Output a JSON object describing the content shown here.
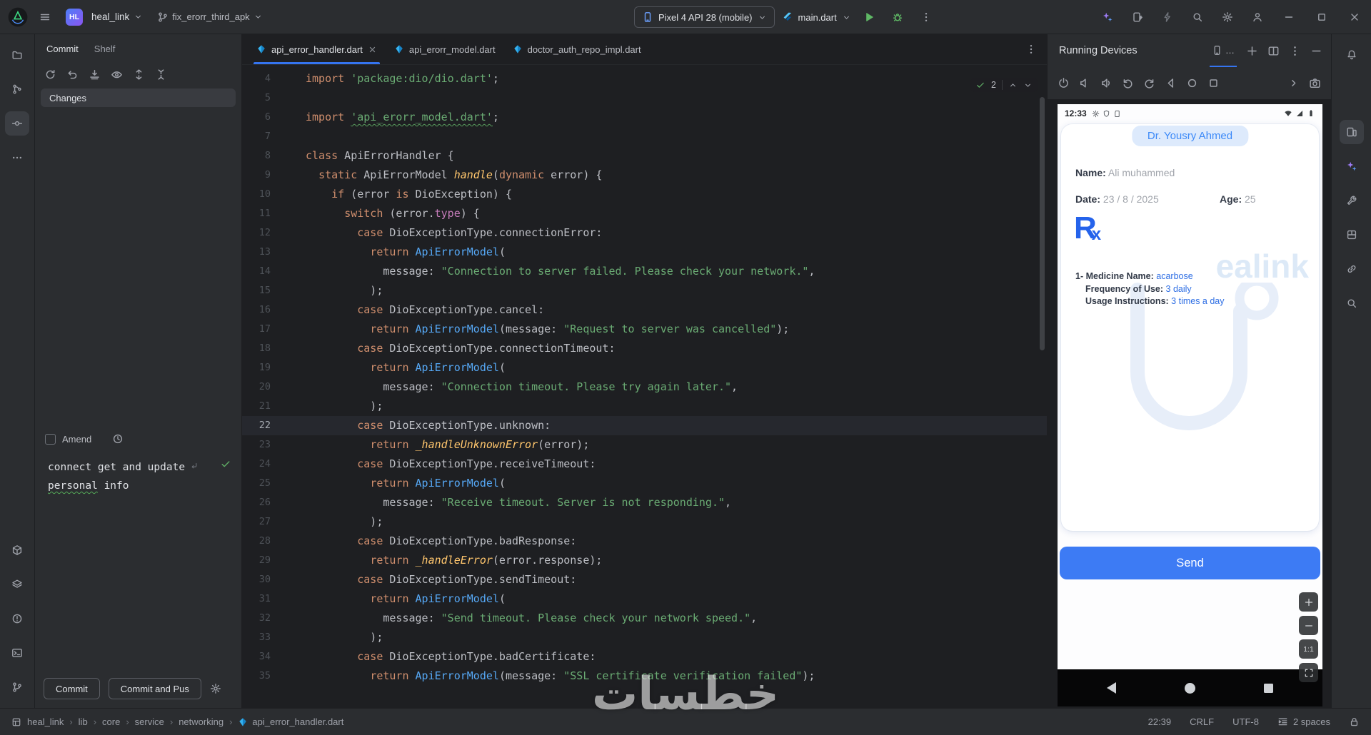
{
  "titlebar": {
    "project": {
      "badge": "HL",
      "name": "heal_link"
    },
    "branch": "fix_erorr_third_apk",
    "device_selector": "Pixel 4 API 28 (mobile)",
    "run_config": "main.dart"
  },
  "commit_panel": {
    "tabs": [
      "Commit",
      "Shelf"
    ],
    "changes_label": "Changes",
    "amend_label": "Amend",
    "message": {
      "line1": "connect get and update",
      "line2_word": "personal",
      "line2_rest": " info"
    },
    "commit_button": "Commit",
    "commit_push_button": "Commit and Pus"
  },
  "editor": {
    "tabs": [
      {
        "label": "api_error_handler.dart"
      },
      {
        "label": "api_erorr_model.dart"
      },
      {
        "label": "doctor_auth_repo_impl.dart"
      }
    ],
    "inspections": {
      "count": "2"
    },
    "code": {
      "current_line": 22,
      "lines": [
        {
          "n": 4,
          "t": [
            {
              "c": "k",
              "x": "import"
            },
            {
              "c": "d",
              "x": " "
            },
            {
              "c": "s",
              "x": "'package:dio/dio.dart'"
            },
            {
              "c": "d",
              "x": ";"
            }
          ]
        },
        {
          "n": 5,
          "t": []
        },
        {
          "n": 6,
          "t": [
            {
              "c": "k",
              "x": "import"
            },
            {
              "c": "d",
              "x": " "
            },
            {
              "c": "s sq",
              "x": "'api_erorr_model.dart'"
            },
            {
              "c": "d",
              "x": ";"
            }
          ]
        },
        {
          "n": 7,
          "t": []
        },
        {
          "n": 8,
          "t": [
            {
              "c": "k",
              "x": "class"
            },
            {
              "c": "d",
              "x": " ApiErrorHandler {"
            }
          ]
        },
        {
          "n": 9,
          "t": [
            {
              "c": "d",
              "x": "  "
            },
            {
              "c": "k",
              "x": "static"
            },
            {
              "c": "d",
              "x": " ApiErrorModel "
            },
            {
              "c": "f",
              "x": "handle"
            },
            {
              "c": "d",
              "x": "("
            },
            {
              "c": "k",
              "x": "dynamic"
            },
            {
              "c": "d",
              "x": " error) {"
            }
          ]
        },
        {
          "n": 10,
          "t": [
            {
              "c": "d",
              "x": "    "
            },
            {
              "c": "k",
              "x": "if"
            },
            {
              "c": "d",
              "x": " (error "
            },
            {
              "c": "k",
              "x": "is"
            },
            {
              "c": "d",
              "x": " DioException) {"
            }
          ]
        },
        {
          "n": 11,
          "t": [
            {
              "c": "d",
              "x": "      "
            },
            {
              "c": "k",
              "x": "switch"
            },
            {
              "c": "d",
              "x": " (error."
            },
            {
              "c": "m",
              "x": "type"
            },
            {
              "c": "d",
              "x": ") {"
            }
          ]
        },
        {
          "n": 12,
          "t": [
            {
              "c": "d",
              "x": "        "
            },
            {
              "c": "k",
              "x": "case"
            },
            {
              "c": "d",
              "x": " DioExceptionType.connectionError:"
            }
          ]
        },
        {
          "n": 13,
          "t": [
            {
              "c": "d",
              "x": "          "
            },
            {
              "c": "k",
              "x": "return"
            },
            {
              "c": "d",
              "x": " "
            },
            {
              "c": "c",
              "x": "ApiErrorModel"
            },
            {
              "c": "d",
              "x": "("
            }
          ]
        },
        {
          "n": 14,
          "t": [
            {
              "c": "d",
              "x": "            message: "
            },
            {
              "c": "s",
              "x": "\"Connection to server failed. Please check your network.\""
            },
            {
              "c": "d",
              "x": ","
            }
          ]
        },
        {
          "n": 15,
          "t": [
            {
              "c": "d",
              "x": "          );"
            }
          ]
        },
        {
          "n": 16,
          "t": [
            {
              "c": "d",
              "x": "        "
            },
            {
              "c": "k",
              "x": "case"
            },
            {
              "c": "d",
              "x": " DioExceptionType.cancel:"
            }
          ]
        },
        {
          "n": 17,
          "t": [
            {
              "c": "d",
              "x": "          "
            },
            {
              "c": "k",
              "x": "return"
            },
            {
              "c": "d",
              "x": " "
            },
            {
              "c": "c",
              "x": "ApiErrorModel"
            },
            {
              "c": "d",
              "x": "(message: "
            },
            {
              "c": "s",
              "x": "\"Request to server was cancelled\""
            },
            {
              "c": "d",
              "x": ");"
            }
          ]
        },
        {
          "n": 18,
          "t": [
            {
              "c": "d",
              "x": "        "
            },
            {
              "c": "k",
              "x": "case"
            },
            {
              "c": "d",
              "x": " DioExceptionType.connectionTimeout:"
            }
          ]
        },
        {
          "n": 19,
          "t": [
            {
              "c": "d",
              "x": "          "
            },
            {
              "c": "k",
              "x": "return"
            },
            {
              "c": "d",
              "x": " "
            },
            {
              "c": "c",
              "x": "ApiErrorModel"
            },
            {
              "c": "d",
              "x": "("
            }
          ]
        },
        {
          "n": 20,
          "t": [
            {
              "c": "d",
              "x": "            message: "
            },
            {
              "c": "s",
              "x": "\"Connection timeout. Please try again later.\""
            },
            {
              "c": "d",
              "x": ","
            }
          ]
        },
        {
          "n": 21,
          "t": [
            {
              "c": "d",
              "x": "          );"
            }
          ]
        },
        {
          "n": 22,
          "t": [
            {
              "c": "d",
              "x": "        "
            },
            {
              "c": "k",
              "x": "case"
            },
            {
              "c": "d",
              "x": " DioExceptionType.unknown:"
            }
          ]
        },
        {
          "n": 23,
          "t": [
            {
              "c": "d",
              "x": "          "
            },
            {
              "c": "k",
              "x": "return"
            },
            {
              "c": "d",
              "x": " "
            },
            {
              "c": "f",
              "x": "_handleUnknownError"
            },
            {
              "c": "d",
              "x": "(error);"
            }
          ]
        },
        {
          "n": 24,
          "t": [
            {
              "c": "d",
              "x": "        "
            },
            {
              "c": "k",
              "x": "case"
            },
            {
              "c": "d",
              "x": " DioExceptionType.receiveTimeout:"
            }
          ]
        },
        {
          "n": 25,
          "t": [
            {
              "c": "d",
              "x": "          "
            },
            {
              "c": "k",
              "x": "return"
            },
            {
              "c": "d",
              "x": " "
            },
            {
              "c": "c",
              "x": "ApiErrorModel"
            },
            {
              "c": "d",
              "x": "("
            }
          ]
        },
        {
          "n": 26,
          "t": [
            {
              "c": "d",
              "x": "            message: "
            },
            {
              "c": "s",
              "x": "\"Receive timeout. Server is not responding.\""
            },
            {
              "c": "d",
              "x": ","
            }
          ]
        },
        {
          "n": 27,
          "t": [
            {
              "c": "d",
              "x": "          );"
            }
          ]
        },
        {
          "n": 28,
          "t": [
            {
              "c": "d",
              "x": "        "
            },
            {
              "c": "k",
              "x": "case"
            },
            {
              "c": "d",
              "x": " DioExceptionType.badResponse:"
            }
          ]
        },
        {
          "n": 29,
          "t": [
            {
              "c": "d",
              "x": "          "
            },
            {
              "c": "k",
              "x": "return"
            },
            {
              "c": "d",
              "x": " "
            },
            {
              "c": "f",
              "x": "_handleError"
            },
            {
              "c": "d",
              "x": "(error.response);"
            }
          ]
        },
        {
          "n": 30,
          "t": [
            {
              "c": "d",
              "x": "        "
            },
            {
              "c": "k",
              "x": "case"
            },
            {
              "c": "d",
              "x": " DioExceptionType.sendTimeout:"
            }
          ]
        },
        {
          "n": 31,
          "t": [
            {
              "c": "d",
              "x": "          "
            },
            {
              "c": "k",
              "x": "return"
            },
            {
              "c": "d",
              "x": " "
            },
            {
              "c": "c",
              "x": "ApiErrorModel"
            },
            {
              "c": "d",
              "x": "("
            }
          ]
        },
        {
          "n": 32,
          "t": [
            {
              "c": "d",
              "x": "            message: "
            },
            {
              "c": "s",
              "x": "\"Send timeout. Please check your network speed.\""
            },
            {
              "c": "d",
              "x": ","
            }
          ]
        },
        {
          "n": 33,
          "t": [
            {
              "c": "d",
              "x": "          );"
            }
          ]
        },
        {
          "n": 34,
          "t": [
            {
              "c": "d",
              "x": "        "
            },
            {
              "c": "k",
              "x": "case"
            },
            {
              "c": "d",
              "x": " DioExceptionType.badCertificate:"
            }
          ]
        },
        {
          "n": 35,
          "t": [
            {
              "c": "d",
              "x": "          "
            },
            {
              "c": "k",
              "x": "return"
            },
            {
              "c": "d",
              "x": " "
            },
            {
              "c": "c",
              "x": "ApiErrorModel"
            },
            {
              "c": "d",
              "x": "(message: "
            },
            {
              "c": "s",
              "x": "\"SSL certificate verification failed\""
            },
            {
              "c": "d",
              "x": ");"
            }
          ]
        }
      ]
    }
  },
  "devices_panel": {
    "title": "Running Devices",
    "tab_more": "…",
    "zoom_label": "1:1",
    "phone": {
      "status_time": "12:33",
      "doctor": "Dr. Yousry Ahmed",
      "name_label": "Name:",
      "name_value": "Ali muhammed",
      "date_label": "Date:",
      "date_value": "23 / 8 / 2025",
      "age_label": "Age:",
      "age_value": "25",
      "rx_large": "R",
      "rx_small": "x",
      "medicine": [
        {
          "label": "1- Medicine Name:",
          "value": "acarbose"
        },
        {
          "label": "Frequency of Use:",
          "value": "3 daily"
        },
        {
          "label": "Usage Instructions:",
          "value": "3 times a day"
        }
      ],
      "watermark": "ealink",
      "send_button": "Send"
    }
  },
  "statusbar": {
    "breadcrumbs": [
      "heal_link",
      "lib",
      "core",
      "service",
      "networking",
      "api_error_handler.dart"
    ],
    "separator": "›",
    "cursor": "22:39",
    "line_ending": "CRLF",
    "encoding": "UTF-8",
    "indent": "2 spaces"
  },
  "overlay_watermark": "خطسات",
  "colors": {
    "accent": "#3574F0",
    "run_green": "#5FB865",
    "keyword": "#CF8E6D",
    "string": "#6AAB73",
    "function": "#FFC66D",
    "class_ref": "#56A8F5",
    "member": "#C77DBB",
    "phone_blue": "#2F6FE4",
    "send_button": "#3D7BF4",
    "doctor_pill_bg": "#DDEAFC"
  },
  "icons": {
    "hamburger-icon": "three horizontal lines",
    "run-icon": "green play triangle",
    "debug-icon": "green bug",
    "search-icon": "magnifier",
    "settings-icon": "gear",
    "profile-icon": "person silhouette",
    "minimize-icon": "–",
    "maximize-icon": "□",
    "close-icon": "×",
    "kebab-icon": "⋮",
    "branch-icon": "git branch nodes",
    "device-icon": "smartphone outline",
    "ai-assistant-icon": "two four-point sparkles",
    "notifications-icon": "bell",
    "nav-back-icon": "◀",
    "nav-home-icon": "●",
    "nav-recents-icon": "■",
    "zoom-in-icon": "+",
    "zoom-out-icon": "−",
    "zoom-fit-icon": "corner brackets",
    "dart-file-icon": "blue diamond",
    "check-icon": "green check",
    "rx-symbol": "Rx prescription sign"
  }
}
